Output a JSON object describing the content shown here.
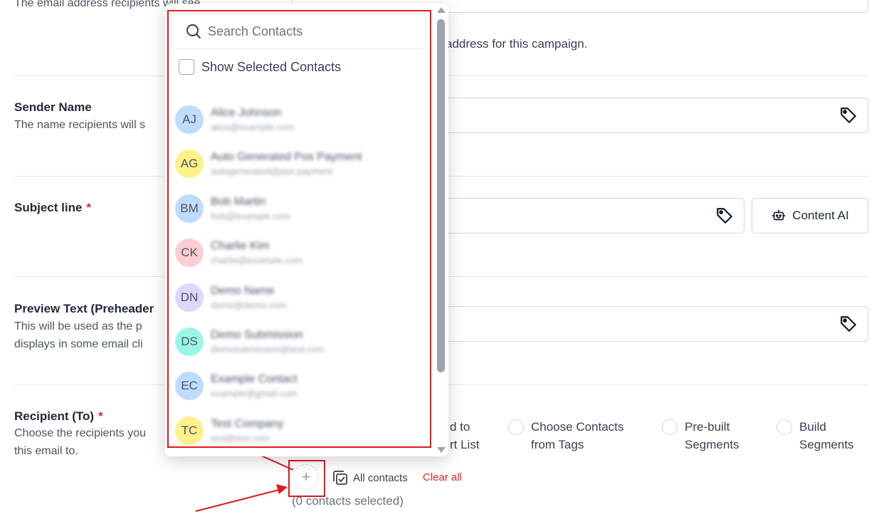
{
  "form": {
    "from_email": {
      "desc": "The email address recipients will see",
      "helper_suffix": "address for this campaign."
    },
    "sender_name": {
      "label": "Sender Name",
      "desc": "The name recipients will s"
    },
    "subject_line": {
      "label": "Subject line",
      "required_mark": "*",
      "content_ai_label": "Content AI"
    },
    "preview_text": {
      "label": "Preview Text (Preheader",
      "desc_line1": "This will be used as the p",
      "desc_line2": "displays in some email cli"
    },
    "recipient": {
      "label": "Recipient (To)",
      "required_mark": "*",
      "desc_line1": "Choose the recipients you",
      "desc_line2": "this email to.",
      "options": [
        {
          "line1": "d to",
          "line2": "rt List"
        },
        {
          "line1": "Choose Contacts",
          "line2": "from Tags"
        },
        {
          "line1": "Pre-built",
          "line2": "Segments"
        },
        {
          "line1": "Build",
          "line2": "Segments"
        }
      ],
      "add_icon": "plus-icon",
      "all_contacts_label": "All contacts",
      "clear_all_label": "Clear all",
      "selected_count": "(0 contacts selected)"
    }
  },
  "dropdown": {
    "search_placeholder": "Search Contacts",
    "show_selected_label": "Show Selected Contacts",
    "contacts": [
      {
        "initials": "AJ",
        "name": "Alice Johnson",
        "email": "alice@example.com",
        "color": "#bfdbfe"
      },
      {
        "initials": "AG",
        "name": "Auto Generated Pos Payment",
        "email": "autogenerated@pos.payment",
        "color": "#fef08a"
      },
      {
        "initials": "BM",
        "name": "Bob Martin",
        "email": "bob@example.com",
        "color": "#bfdbfe"
      },
      {
        "initials": "CK",
        "name": "Charlie Kim",
        "email": "charlie@example.com",
        "color": "#fecdd3"
      },
      {
        "initials": "DN",
        "name": "Demo Name",
        "email": "demo@demo.com",
        "color": "#ddd6fe"
      },
      {
        "initials": "DS",
        "name": "Demo Submission",
        "email": "demosubmission@test.com",
        "color": "#99f6e4"
      },
      {
        "initials": "EC",
        "name": "Example Contact",
        "email": "example@gmail.com",
        "color": "#bfdbfe"
      },
      {
        "initials": "TC",
        "name": "Test Company",
        "email": "test@test.com",
        "color": "#fef08a"
      }
    ]
  },
  "colors": {
    "annotation": "#e0191b",
    "required": "#dc2626"
  }
}
